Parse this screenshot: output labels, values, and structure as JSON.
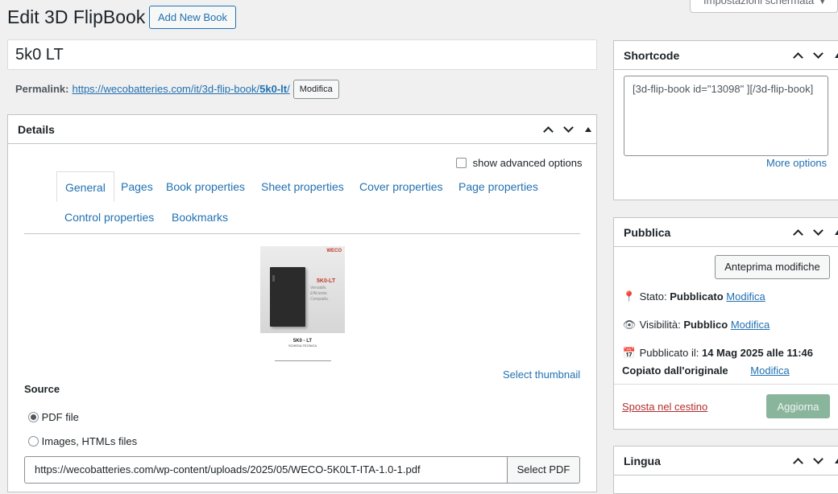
{
  "header": {
    "title": "Edit 3D FlipBook",
    "add_new": "Add New Book",
    "screen_options": "Impostazioni schermata"
  },
  "post": {
    "title": "5k0 LT",
    "permalink_label": "Permalink:",
    "permalink_base": "https://wecobatteries.com/it/3d-flip-book/",
    "permalink_slug": "5k0-lt",
    "permalink_end": "/",
    "edit_button": "Modifica"
  },
  "details": {
    "title": "Details",
    "advanced_label": "show advanced options",
    "tabs": [
      "General",
      "Pages",
      "Book properties",
      "Sheet properties",
      "Cover properties",
      "Page properties",
      "Control properties",
      "Bookmarks"
    ],
    "thumbnail": {
      "brand": "WECO",
      "model": "5K0-LT",
      "tagline": [
        "Versatile.",
        "Efficiente.",
        "Compatto."
      ],
      "footer_title": "5K0 - LT",
      "footer_sub": "SCHEDA TECNICA"
    },
    "select_thumbnail": "Select thumbnail",
    "source_label": "Source",
    "source_options": [
      "PDF file",
      "Images, HTMLs files"
    ],
    "pdf_url": "https://wecobatteries.com/wp-content/uploads/2025/05/WECO-5K0LT-ITA-1.0-1.pdf",
    "select_pdf": "Select PDF"
  },
  "shortcode": {
    "title": "Shortcode",
    "value": "[3d-flip-book id=\"13098\" ][/3d-flip-book]",
    "more_options": "More options"
  },
  "publish": {
    "title": "Pubblica",
    "preview": "Anteprima modifiche",
    "status_label": "Stato:",
    "status_value": "Pubblicato",
    "visibility_label": "Visibilità:",
    "visibility_value": "Pubblico",
    "published_label": "Pubblicato il:",
    "published_value": "14 Mag 2025 alle 11:46",
    "copied_label": "Copiato dall'originale",
    "edit": "Modifica",
    "trash": "Sposta nel cestino",
    "update": "Aggiorna"
  },
  "lingua": {
    "title": "Lingua"
  }
}
